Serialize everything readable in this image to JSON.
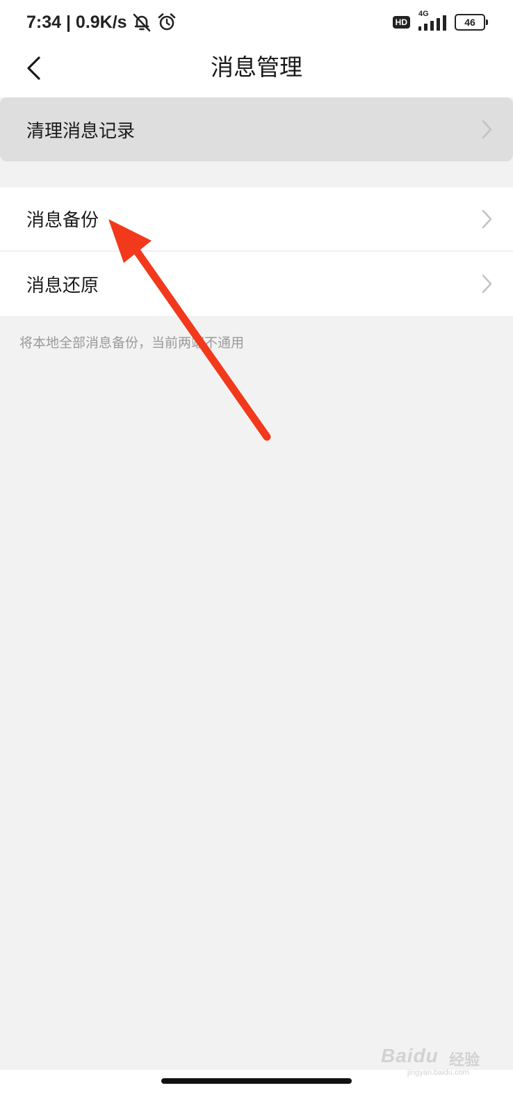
{
  "status_bar": {
    "time_speed": "7:34 | 0.9K/s",
    "hd_label": "HD",
    "network_type": "4G",
    "battery_level": "46",
    "icons": [
      "mute-bell-icon",
      "alarm-clock-icon",
      "signal-icon",
      "battery-icon"
    ]
  },
  "header": {
    "title": "消息管理",
    "back_icon": "chevron-left-icon"
  },
  "menu": {
    "items": [
      {
        "label": "清理消息记录",
        "icon": "chevron-right-icon"
      },
      {
        "label": "消息备份",
        "icon": "chevron-right-icon"
      },
      {
        "label": "消息还原",
        "icon": "chevron-right-icon"
      }
    ]
  },
  "hint": "将本地全部消息备份，当前两端不通用",
  "annotation": {
    "arrow_color": "#f2391c"
  },
  "watermark": {
    "brand": "Baidu",
    "cn": "经验",
    "sub": "jingyan.baidu.com"
  }
}
